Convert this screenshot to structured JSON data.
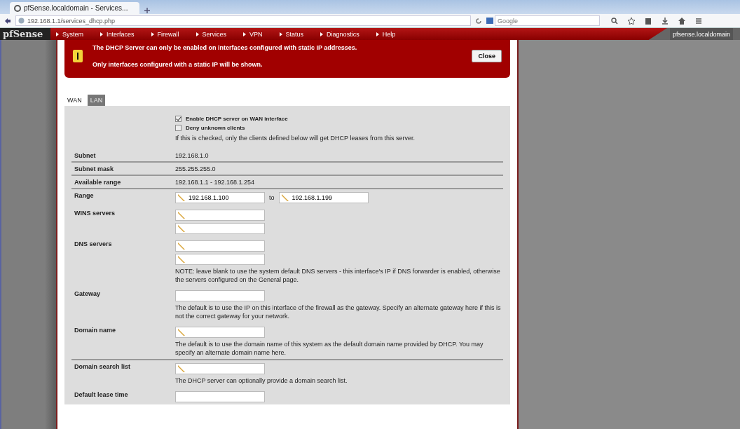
{
  "browser": {
    "tab_title": "pfSense.localdomain - Services...",
    "url": "192.168.1.1/services_dhcp.php",
    "search_placeholder": "Google"
  },
  "header": {
    "logo": "pfSense",
    "menu": [
      {
        "label": "System"
      },
      {
        "label": "Interfaces"
      },
      {
        "label": "Firewall"
      },
      {
        "label": "Services"
      },
      {
        "label": "VPN"
      },
      {
        "label": "Status"
      },
      {
        "label": "Diagnostics"
      },
      {
        "label": "Help"
      }
    ],
    "hostname": "pfsense.localdomain"
  },
  "alert": {
    "lines": [
      "The DHCP Server can only be enabled on interfaces configured with static IP addresses.",
      "Only interfaces configured with a static IP will be shown."
    ],
    "button": "Close"
  },
  "tabs": [
    {
      "label": "WAN",
      "selected": true
    },
    {
      "label": "LAN",
      "selected": false
    }
  ],
  "options": [
    {
      "label": "Enable DHCP server on WAN interface",
      "checked": true
    },
    {
      "label": "Deny unknown clients",
      "checked": false,
      "note": "If this is checked, only the clients defined below will get DHCP leases from this server."
    }
  ],
  "rows": [
    {
      "kind": "info",
      "label": "Subnet",
      "value": "192.168.1.0",
      "separated": false
    },
    {
      "kind": "info",
      "label": "Subnet mask",
      "value": "255.255.255.0",
      "separated": true
    },
    {
      "kind": "info",
      "label": "Available range",
      "value": "192.168.1.1 - 192.168.1.254",
      "separated": true
    },
    {
      "kind": "range",
      "label": "Range",
      "from": "192.168.1.100",
      "separator": "to",
      "to": "192.168.1.199",
      "separated": true
    },
    {
      "kind": "fields",
      "label": "WINS servers",
      "fields": [
        {
          "edit_icon": true
        },
        {
          "edit_icon": true
        }
      ],
      "separated": false
    },
    {
      "kind": "fields",
      "label": "DNS servers",
      "fields": [
        {
          "edit_icon": true
        },
        {
          "edit_icon": true
        }
      ],
      "note": "NOTE: leave blank to use the system default DNS servers - this interface's IP if DNS forwarder is enabled, otherwise the servers configured on the General page.",
      "separated": false
    },
    {
      "kind": "fields",
      "label": "Gateway",
      "fields": [
        {
          "edit_icon": false
        }
      ],
      "note": "The default is to use the IP on this interface of the firewall as the gateway. Specify an alternate gateway here if this is not the correct gateway for your network.",
      "separated": false
    },
    {
      "kind": "fields",
      "label": "Domain name",
      "fields": [
        {
          "edit_icon": true
        }
      ],
      "note": "The default is to use the domain name of this system as the default domain name provided by DHCP. You may specify an alternate domain name here.",
      "separated": false
    },
    {
      "kind": "fields",
      "label": "Domain search list",
      "fields": [
        {
          "edit_icon": true
        }
      ],
      "note": "The DHCP server can optionally provide a domain search list.",
      "separated": true
    },
    {
      "kind": "fields",
      "label": "Default lease time",
      "fields": [
        {
          "edit_icon": false
        }
      ],
      "separated": false
    }
  ]
}
